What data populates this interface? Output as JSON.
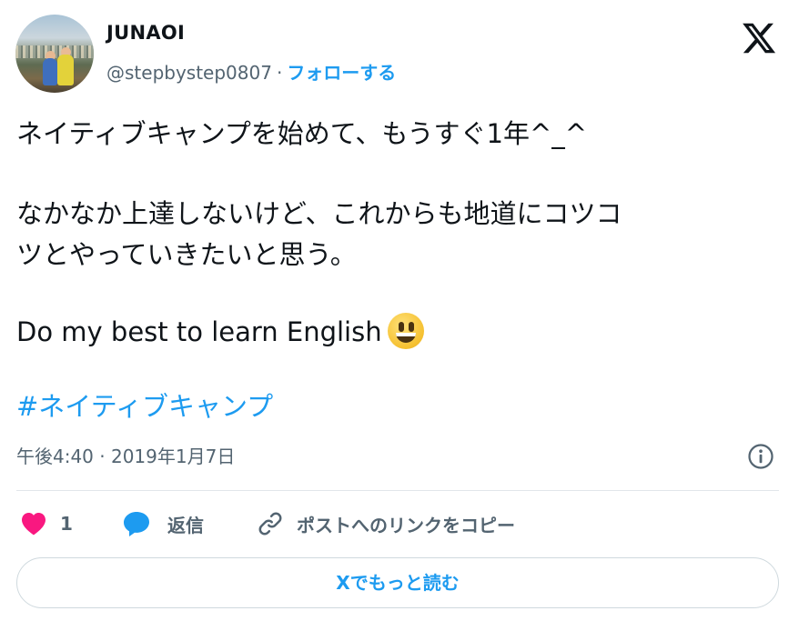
{
  "author": {
    "name": "JUNAOI",
    "handle": "@stepbystep0807",
    "separator": "·",
    "follow_label": "フォローする"
  },
  "tweet": {
    "line1": "ネイティブキャンプを始めて、もうすぐ1年^_^",
    "line2": "なかなか上達しないけど、これからも地道にコツコ",
    "line3": "ツとやっていきたいと思う。",
    "line4": "Do my best to learn English",
    "emoji": "grinning-face-emoji",
    "hashtag": "#ネイティブキャンプ"
  },
  "meta": {
    "timestamp": "午後4:40 · 2019年1月7日"
  },
  "actions": {
    "like_count": "1",
    "reply_label": "返信",
    "copy_link_label": "ポストへのリンクをコピー"
  },
  "footer": {
    "read_more_label": "Xでもっと読む"
  },
  "colors": {
    "accent": "#1d9bf0",
    "text": "#0f1419",
    "secondary": "#536471",
    "like": "#f91880",
    "border": "#cfd9de"
  }
}
